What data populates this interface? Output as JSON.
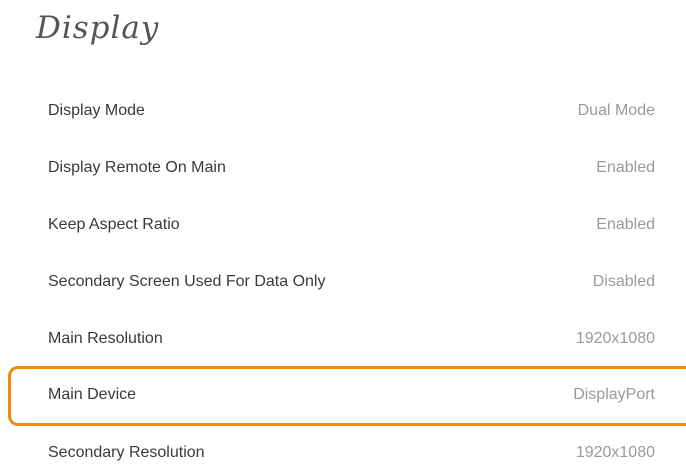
{
  "page": {
    "title": "Display"
  },
  "settings": [
    {
      "label": "Display Mode",
      "value": "Dual Mode"
    },
    {
      "label": "Display Remote On Main",
      "value": "Enabled"
    },
    {
      "label": "Keep Aspect Ratio",
      "value": "Enabled"
    },
    {
      "label": "Secondary Screen Used For Data Only",
      "value": "Disabled"
    },
    {
      "label": "Main Resolution",
      "value": "1920x1080"
    },
    {
      "label": "Main Device",
      "value": "DisplayPort",
      "selected": true
    },
    {
      "label": "Secondary Resolution",
      "value": "1920x1080"
    }
  ],
  "colors": {
    "highlight": "#f28a0f",
    "label": "#3a3a3a",
    "value": "#9a9a9a"
  }
}
